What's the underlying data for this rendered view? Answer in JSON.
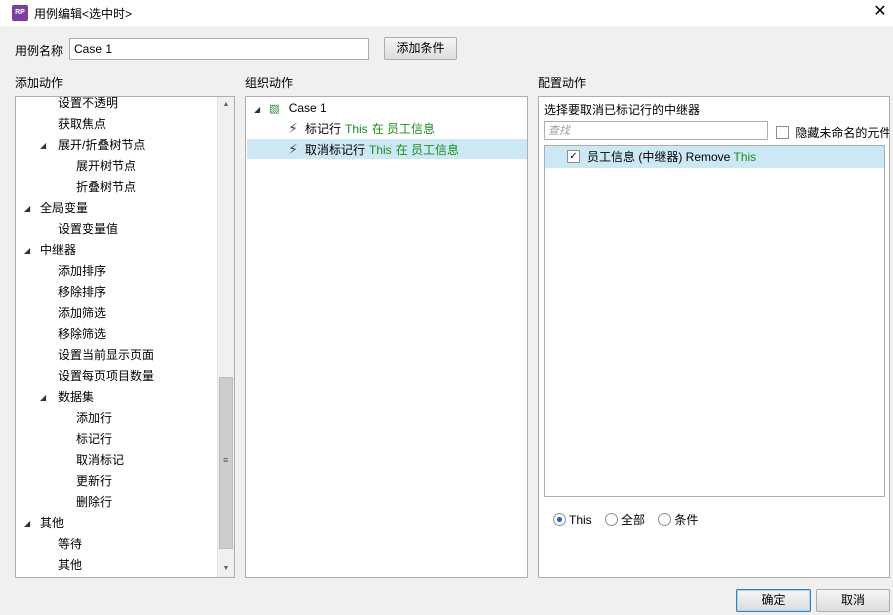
{
  "window": {
    "app_icon_text": "RP",
    "title": "用例编辑<选中时>",
    "close_glyph": "✕"
  },
  "case_name": {
    "label": "用例名称",
    "value": "Case 1",
    "add_condition_label": "添加条件"
  },
  "add_actions": {
    "header": "添加动作",
    "items": [
      {
        "label": "设置不透明",
        "level": 1,
        "expander": false
      },
      {
        "label": "获取焦点",
        "level": 1,
        "expander": false
      },
      {
        "label": "展开/折叠树节点",
        "level": 1,
        "expander": true
      },
      {
        "label": "展开树节点",
        "level": 2,
        "expander": false
      },
      {
        "label": "折叠树节点",
        "level": 2,
        "expander": false
      },
      {
        "label": "全局变量",
        "level": 0,
        "expander": true
      },
      {
        "label": "设置变量值",
        "level": 1,
        "expander": false
      },
      {
        "label": "中继器",
        "level": 0,
        "expander": true
      },
      {
        "label": "添加排序",
        "level": 1,
        "expander": false
      },
      {
        "label": "移除排序",
        "level": 1,
        "expander": false
      },
      {
        "label": "添加筛选",
        "level": 1,
        "expander": false
      },
      {
        "label": "移除筛选",
        "level": 1,
        "expander": false
      },
      {
        "label": "设置当前显示页面",
        "level": 1,
        "expander": false
      },
      {
        "label": "设置每页项目数量",
        "level": 1,
        "expander": false
      },
      {
        "label": "数据集",
        "level": 1,
        "expander": true
      },
      {
        "label": "添加行",
        "level": 2,
        "expander": false
      },
      {
        "label": "标记行",
        "level": 2,
        "expander": false
      },
      {
        "label": "取消标记",
        "level": 2,
        "expander": false
      },
      {
        "label": "更新行",
        "level": 2,
        "expander": false
      },
      {
        "label": "删除行",
        "level": 2,
        "expander": false
      },
      {
        "label": "其他",
        "level": 0,
        "expander": true
      },
      {
        "label": "等待",
        "level": 1,
        "expander": false
      },
      {
        "label": "其他",
        "level": 1,
        "expander": false
      }
    ],
    "expander_glyph": "◢",
    "scroll_up_glyph": "▲",
    "scroll_down_glyph": "▼",
    "scroll_grip_glyph": "≡"
  },
  "organize_actions": {
    "header": "组织动作",
    "case_label": "Case 1",
    "case_icon": "tree-node-icon",
    "actions": [
      {
        "verb": "标记行",
        "target_this": "This",
        "rest": "在 员工信息",
        "selected": false
      },
      {
        "verb": "取消标记行",
        "target_this": "This",
        "rest": "在 员工信息",
        "selected": true
      }
    ],
    "bolt_glyph": "⚡"
  },
  "configure_actions": {
    "header": "配置动作",
    "prompt": "选择要取消已标记行的中继器",
    "search_placeholder": "查找",
    "hide_unnamed_label": "隐藏未命名的元件",
    "hide_unnamed_checked": false,
    "repeaters": [
      {
        "name": "员工信息 (中继器) Remove",
        "this": "This",
        "checked": true
      }
    ],
    "check_glyph": "✓",
    "radio_options": [
      {
        "label": "This",
        "selected": true
      },
      {
        "label": "全部",
        "selected": false
      },
      {
        "label": "条件",
        "selected": false
      }
    ]
  },
  "footer": {
    "ok_label": "确定",
    "cancel_label": "取消"
  },
  "colors": {
    "selection": "#cce8f4",
    "this_green": "#1e8c1e",
    "app_icon": "#7b3fa0"
  }
}
